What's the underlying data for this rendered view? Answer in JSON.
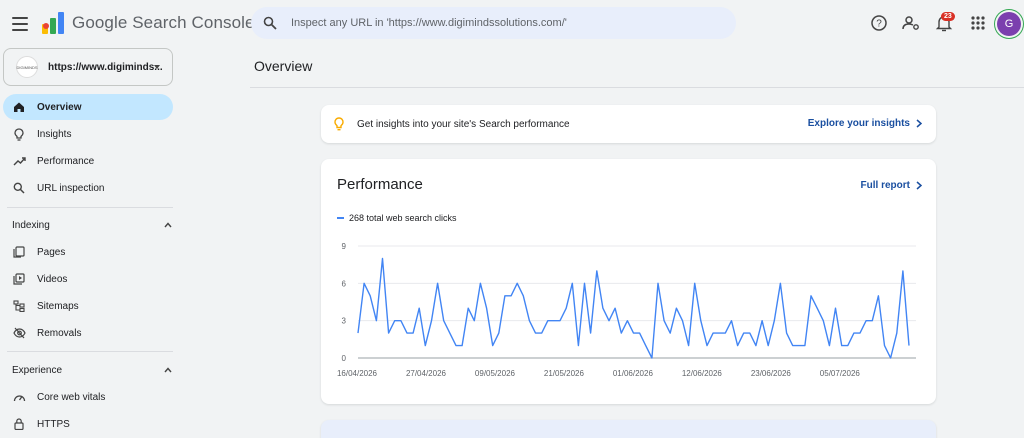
{
  "app": {
    "title": "Google Search Console"
  },
  "search": {
    "placeholder": "Inspect any URL in 'https://www.digimindssolutions.com/'"
  },
  "notifications": {
    "count": "23"
  },
  "user": {
    "initial": "G"
  },
  "property": {
    "name": "https://www.digiminds...",
    "logo_text": "DIGIMINDS"
  },
  "sidebar": {
    "items": [
      {
        "label": "Overview",
        "icon": "home-icon",
        "active": true
      },
      {
        "label": "Insights",
        "icon": "lightbulb-icon"
      },
      {
        "label": "Performance",
        "icon": "trending-up-icon"
      },
      {
        "label": "URL inspection",
        "icon": "search-icon"
      }
    ],
    "indexing": {
      "label": "Indexing",
      "items": [
        {
          "label": "Pages",
          "icon": "pages-icon"
        },
        {
          "label": "Videos",
          "icon": "video-icon"
        },
        {
          "label": "Sitemaps",
          "icon": "sitemap-icon"
        },
        {
          "label": "Removals",
          "icon": "visibility-off-icon"
        }
      ]
    },
    "experience": {
      "label": "Experience",
      "items": [
        {
          "label": "Core web vitals",
          "icon": "speedometer-icon"
        },
        {
          "label": "HTTPS",
          "icon": "lock-icon"
        }
      ]
    }
  },
  "main": {
    "title": "Overview",
    "insight": {
      "text": "Get insights into your site's Search performance",
      "link": "Explore your insights"
    },
    "performance": {
      "title": "Performance",
      "link": "Full report",
      "legend": "268 total web search clicks"
    }
  },
  "colors": {
    "accent": "#1a73e8",
    "line": "#4285f4",
    "active_nav": "#c2e7ff"
  },
  "chart_data": {
    "type": "line",
    "title": "",
    "xlabel": "",
    "ylabel": "",
    "ylim": [
      0,
      9
    ],
    "yticks": [
      0,
      3,
      6,
      9
    ],
    "xticks": [
      "16/04/2026",
      "27/04/2026",
      "09/05/2026",
      "21/05/2026",
      "01/06/2026",
      "12/06/2026",
      "23/06/2026",
      "05/07/2026"
    ],
    "grid": true,
    "series": [
      {
        "name": "268 total web search clicks",
        "x_start": "2026-04-16",
        "values": [
          2,
          6,
          5,
          3,
          8,
          2,
          3,
          3,
          2,
          2,
          4,
          1,
          3,
          6,
          3,
          2,
          1,
          1,
          4,
          3,
          6,
          4,
          1,
          2,
          5,
          5,
          6,
          5,
          3,
          2,
          2,
          3,
          3,
          3,
          4,
          6,
          1,
          6,
          2,
          7,
          4,
          3,
          4,
          2,
          3,
          2,
          2,
          1,
          0,
          6,
          3,
          2,
          4,
          3,
          1,
          6,
          3,
          1,
          2,
          2,
          2,
          3,
          1,
          2,
          2,
          1,
          3,
          1,
          3,
          6,
          2,
          1,
          1,
          1,
          5,
          4,
          3,
          1,
          4,
          1,
          1,
          2,
          2,
          3,
          3,
          5,
          1,
          0,
          2,
          7,
          1
        ]
      }
    ]
  }
}
